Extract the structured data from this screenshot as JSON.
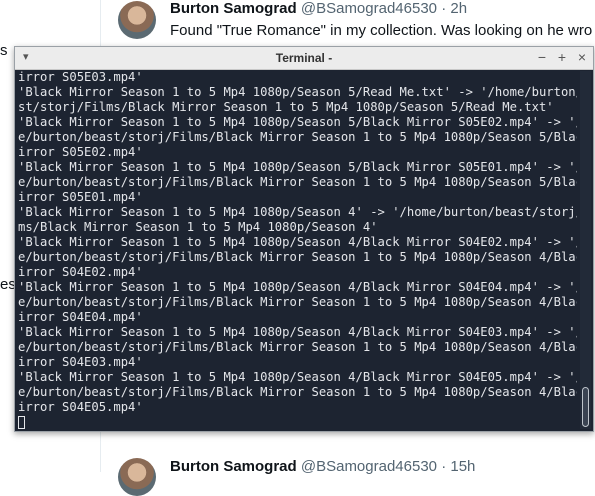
{
  "feed": {
    "posts": [
      {
        "name": "Burton Samograd",
        "handle": "@BSamograd46530",
        "time": "· 2h",
        "text": "Found \"True Romance\" in my collection.  Was looking on he wro"
      },
      {
        "name": "Burton Samograd",
        "handle": "@BSamograd46530",
        "time": "· 15h",
        "text": ""
      }
    ],
    "side_fragments": [
      "s",
      "es"
    ]
  },
  "terminal": {
    "title": "Terminal -",
    "menu_icon": "chevron-down-icon",
    "controls": {
      "minimize": "−",
      "maximize": "+",
      "close": "×"
    },
    "lines": [
      "irror S05E03.mp4'",
      "'Black Mirror Season 1 to 5 Mp4 1080p/Season 5/Read Me.txt' -> '/home/burton/beast/storj/Films/Black Mirror Season 1 to 5 Mp4 1080p/Season 5/Read Me.txt'",
      "st/storj/Films/Black Mirror Season 1 to 5 Mp4 1080p/Season 5/Read Me.txt'",
      "'Black Mirror Season 1 to 5 Mp4 1080p/Season 5/Black Mirror S05E02.mp4' -> '/hom",
      "e/burton/beast/storj/Films/Black Mirror Season 1 to 5 Mp4 1080p/Season 5/Black M",
      "irror S05E02.mp4'",
      "'Black Mirror Season 1 to 5 Mp4 1080p/Season 5/Black Mirror S05E01.mp4' -> '/hom",
      "e/burton/beast/storj/Films/Black Mirror Season 1 to 5 Mp4 1080p/Season 5/Black M",
      "irror S05E01.mp4'",
      "'Black Mirror Season 1 to 5 Mp4 1080p/Season 4' -> '/home/burton/beast/storj/Fil",
      "ms/Black Mirror Season 1 to 5 Mp4 1080p/Season 4'",
      "'Black Mirror Season 1 to 5 Mp4 1080p/Season 4/Black Mirror S04E02.mp4' -> '/hom",
      "e/burton/beast/storj/Films/Black Mirror Season 1 to 5 Mp4 1080p/Season 4/Black M",
      "irror S04E02.mp4'",
      "'Black Mirror Season 1 to 5 Mp4 1080p/Season 4/Black Mirror S04E04.mp4' -> '/hom",
      "e/burton/beast/storj/Films/Black Mirror Season 1 to 5 Mp4 1080p/Season 4/Black M",
      "irror S04E04.mp4'",
      "'Black Mirror Season 1 to 5 Mp4 1080p/Season 4/Black Mirror S04E03.mp4' -> '/hom",
      "e/burton/beast/storj/Films/Black Mirror Season 1 to 5 Mp4 1080p/Season 4/Black M",
      "irror S04E03.mp4'",
      "'Black Mirror Season 1 to 5 Mp4 1080p/Season 4/Black Mirror S04E05.mp4' -> '/hom",
      "e/burton/beast/storj/Films/Black Mirror Season 1 to 5 Mp4 1080p/Season 4/Black M",
      "irror S04E05.mp4'"
    ]
  }
}
